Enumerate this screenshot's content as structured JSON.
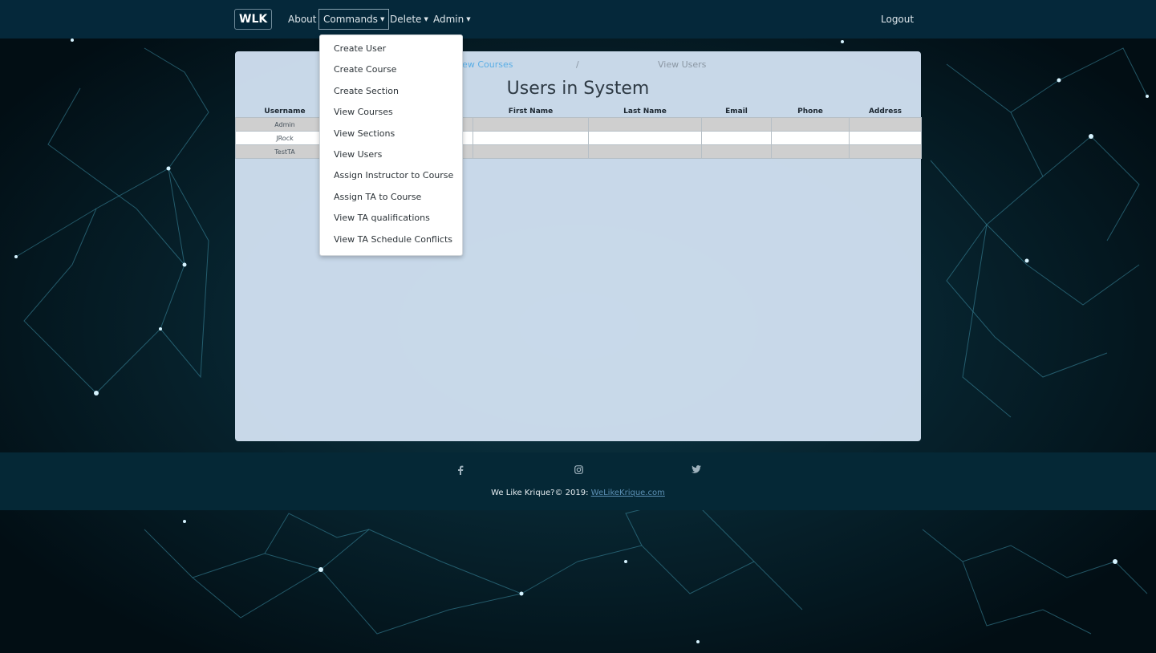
{
  "navbar": {
    "brand": "WLK",
    "about": "About",
    "commands": "Commands",
    "delete": "Delete",
    "admin": "Admin",
    "logout": "Logout"
  },
  "dropdown": {
    "items": [
      "Create User",
      "Create Course",
      "Create Section",
      "View Courses",
      "View Sections",
      "View Users",
      "Assign Instructor to Course",
      "Assign TA to Course",
      "View TA qualifications",
      "View TA Schedule Conflicts"
    ]
  },
  "breadcrumb": {
    "view_courses": "iew Courses",
    "separator": "/",
    "view_users": "View Users"
  },
  "main": {
    "title": "Users in System",
    "columns": [
      "Username",
      "",
      "First Name",
      "Last Name",
      "Email",
      "Phone",
      "Address"
    ],
    "rows": [
      {
        "username": "Admin"
      },
      {
        "username": "JRock"
      },
      {
        "username": "TestTA"
      }
    ]
  },
  "footer": {
    "icons": [
      "facebook-icon",
      "instagram-icon",
      "twitter-icon"
    ],
    "copyright": "We Like Krique?© 2019: ",
    "link": "WeLikeKrique.com"
  },
  "colors": {
    "navbar": "#05283a",
    "panel": "#d0e0f0",
    "accent_link": "#5aaee6",
    "footer": "#052836"
  }
}
